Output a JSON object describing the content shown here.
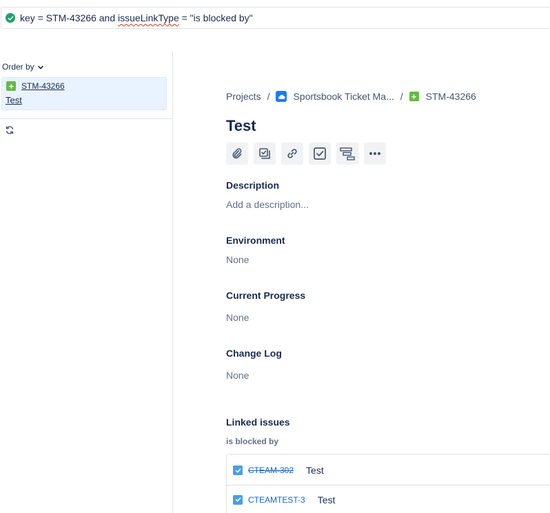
{
  "search": {
    "jql_prefix": "key = STM-43266 and ",
    "jql_flagged": "issueLinkType",
    "jql_suffix": " = \"is blocked by\""
  },
  "sidebar": {
    "order_by_label": "Order by",
    "results": [
      {
        "key": "STM-43266",
        "summary": "Test"
      }
    ]
  },
  "breadcrumb": {
    "projects": "Projects",
    "separator": "/",
    "project": "Sportsbook Ticket Ma...",
    "issue_key": "STM-43266"
  },
  "issue": {
    "title": "Test",
    "description": {
      "heading": "Description",
      "placeholder": "Add a description..."
    },
    "environment": {
      "heading": "Environment",
      "value": "None"
    },
    "current_progress": {
      "heading": "Current Progress",
      "value": "None"
    },
    "change_log": {
      "heading": "Change Log",
      "value": "None"
    },
    "linked_issues": {
      "heading": "Linked issues",
      "link_type": "is blocked by",
      "items": [
        {
          "key": "CTEAM-302",
          "summary": "Test",
          "resolved": true
        },
        {
          "key": "CTEAMTEST-3",
          "summary": "Test",
          "resolved": false
        }
      ]
    }
  },
  "toolbar": {
    "icons": [
      "paperclip-icon",
      "subtask-icon",
      "link-icon",
      "checkbox-icon",
      "roadmap-icon",
      "more-icon"
    ]
  },
  "colors": {
    "story_green": "#65ba43",
    "project_blue": "#1d7afc",
    "link_blue": "#0c66e4",
    "success_green": "#22a06b",
    "selected_bg": "#e9f2ff"
  }
}
